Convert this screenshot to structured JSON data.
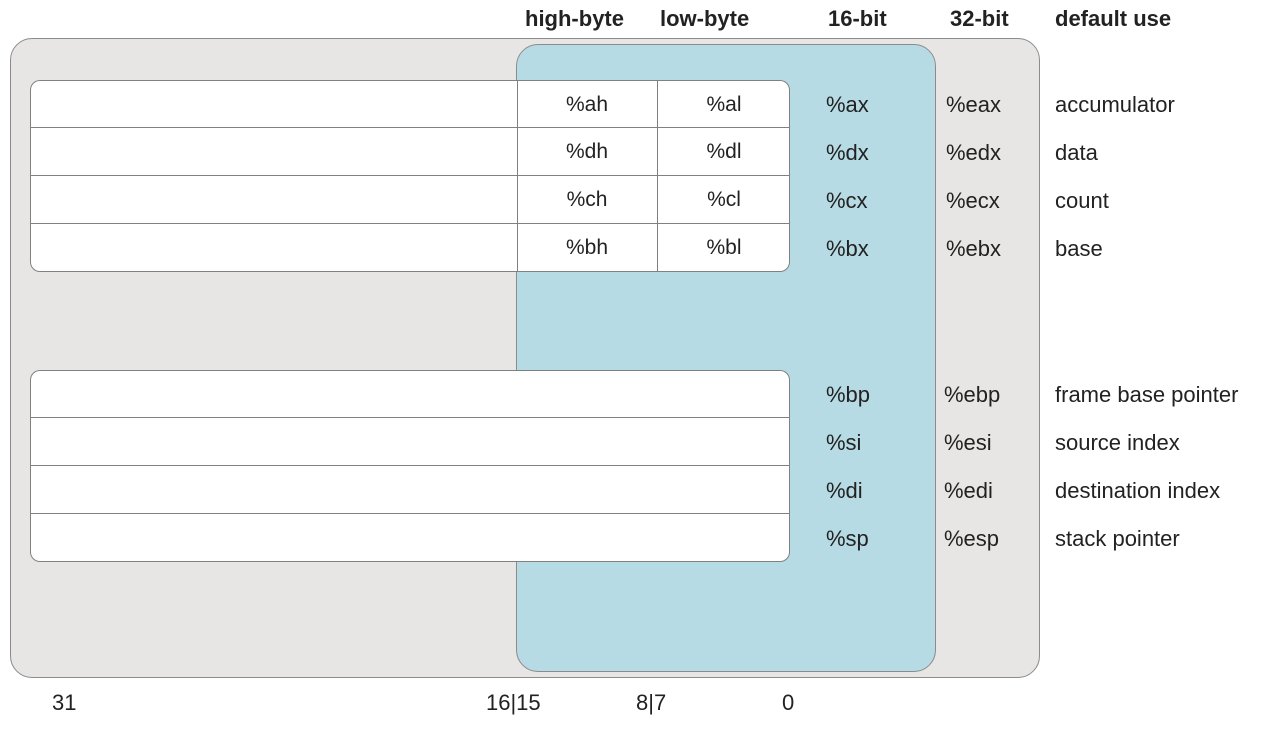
{
  "headers": {
    "high_byte": "high-byte",
    "low_byte": "low-byte",
    "b16": "16-bit",
    "b32": "32-bit",
    "default_use": "default use"
  },
  "registers_top": [
    {
      "hi": "%ah",
      "lo": "%al",
      "r16": "%ax",
      "r32": "%eax",
      "use": "accumulator"
    },
    {
      "hi": "%dh",
      "lo": "%dl",
      "r16": "%dx",
      "r32": "%edx",
      "use": "data"
    },
    {
      "hi": "%ch",
      "lo": "%cl",
      "r16": "%cx",
      "r32": "%ecx",
      "use": "count"
    },
    {
      "hi": "%bh",
      "lo": "%bl",
      "r16": "%bx",
      "r32": "%ebx",
      "use": "base"
    }
  ],
  "registers_bottom": [
    {
      "r16": "%bp",
      "r32": "%ebp",
      "use": "frame base pointer"
    },
    {
      "r16": "%si",
      "r32": "%esi",
      "use": "source index"
    },
    {
      "r16": "%di",
      "r32": "%edi",
      "use": "destination index"
    },
    {
      "r16": "%sp",
      "r32": "%esp",
      "use": "stack pointer"
    }
  ],
  "bit_labels": {
    "b31": "31",
    "b16_15": "16|15",
    "b8_7": "8|7",
    "b0": "0"
  },
  "colors": {
    "panel32": "#e7e6e4",
    "panel16": "#b7dbe5",
    "border": "#808080"
  }
}
